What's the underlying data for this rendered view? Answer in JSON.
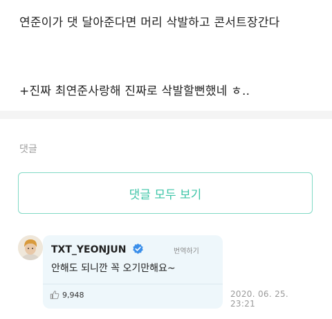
{
  "post": {
    "line1": "연준이가 댓 달아준다면 머리 삭발하고 콘서트장간다",
    "line2": "+진짜 최연준사랑해 진짜로 삭발할뻔했네 ㅎ.."
  },
  "comments_section": {
    "heading": "댓글",
    "view_all_label": "댓글 모두 보기",
    "accent_color": "#3cc4a7"
  },
  "comment": {
    "author": "TXT_YEONJUN",
    "verified": true,
    "translate_label": "번역하기",
    "text": "안해도 되니깐 꼭 오기만해요~",
    "likes": "9,948",
    "timestamp": "2020. 06. 25. 23:21",
    "bubble_color": "#eef7fb"
  }
}
